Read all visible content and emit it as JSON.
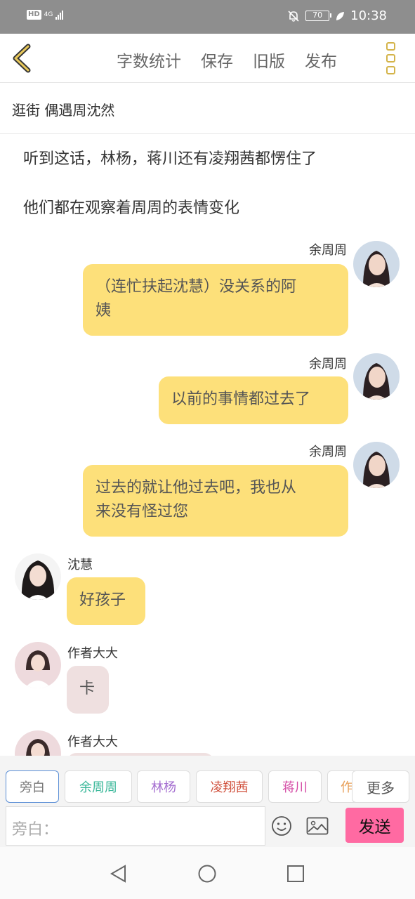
{
  "status_bar": {
    "hd": "HD",
    "network": "4G",
    "battery": "70",
    "time": "10:38"
  },
  "header": {
    "actions": [
      "字数统计",
      "保存",
      "旧版",
      "发布"
    ]
  },
  "chapter": {
    "title": "逛街  偶遇周沈然"
  },
  "messages": {
    "narration_1": "听到这话，林杨，蒋川还有凌翔茜都愣住了",
    "narration_2": "他们都在观察着周周的表情变化",
    "m1": {
      "speaker": "余周周",
      "line1": "（连忙扶起沈慧）没关系的阿",
      "line2": "姨"
    },
    "m2": {
      "speaker": "余周周",
      "text": "以前的事情都过去了"
    },
    "m3": {
      "speaker": "余周周",
      "line1": "过去的就让他过去吧，我也从",
      "line2": "来没有怪过您"
    },
    "m4": {
      "speaker": "沈慧",
      "text": "好孩子"
    },
    "m5": {
      "speaker": "作者大大",
      "text": "卡"
    },
    "m6": {
      "speaker": "作者大大"
    }
  },
  "role_tags": [
    {
      "label": "旁白",
      "color": "#777777"
    },
    {
      "label": "余周周",
      "color": "#3bb89a"
    },
    {
      "label": "林杨",
      "color": "#a46dd0"
    },
    {
      "label": "凌翔茜",
      "color": "#d0503c"
    },
    {
      "label": "蒋川",
      "color": "#d44aa5"
    },
    {
      "label": "作",
      "color": "#e8a05a"
    }
  ],
  "more_label": "更多",
  "input": {
    "placeholder": "旁白："
  },
  "send_label": "发送",
  "colors": {
    "bubble_self": "#fde07a",
    "bubble_author": "#efe0e0",
    "send_button": "#ff6aa2",
    "accent_icon": "#d4b44a"
  }
}
